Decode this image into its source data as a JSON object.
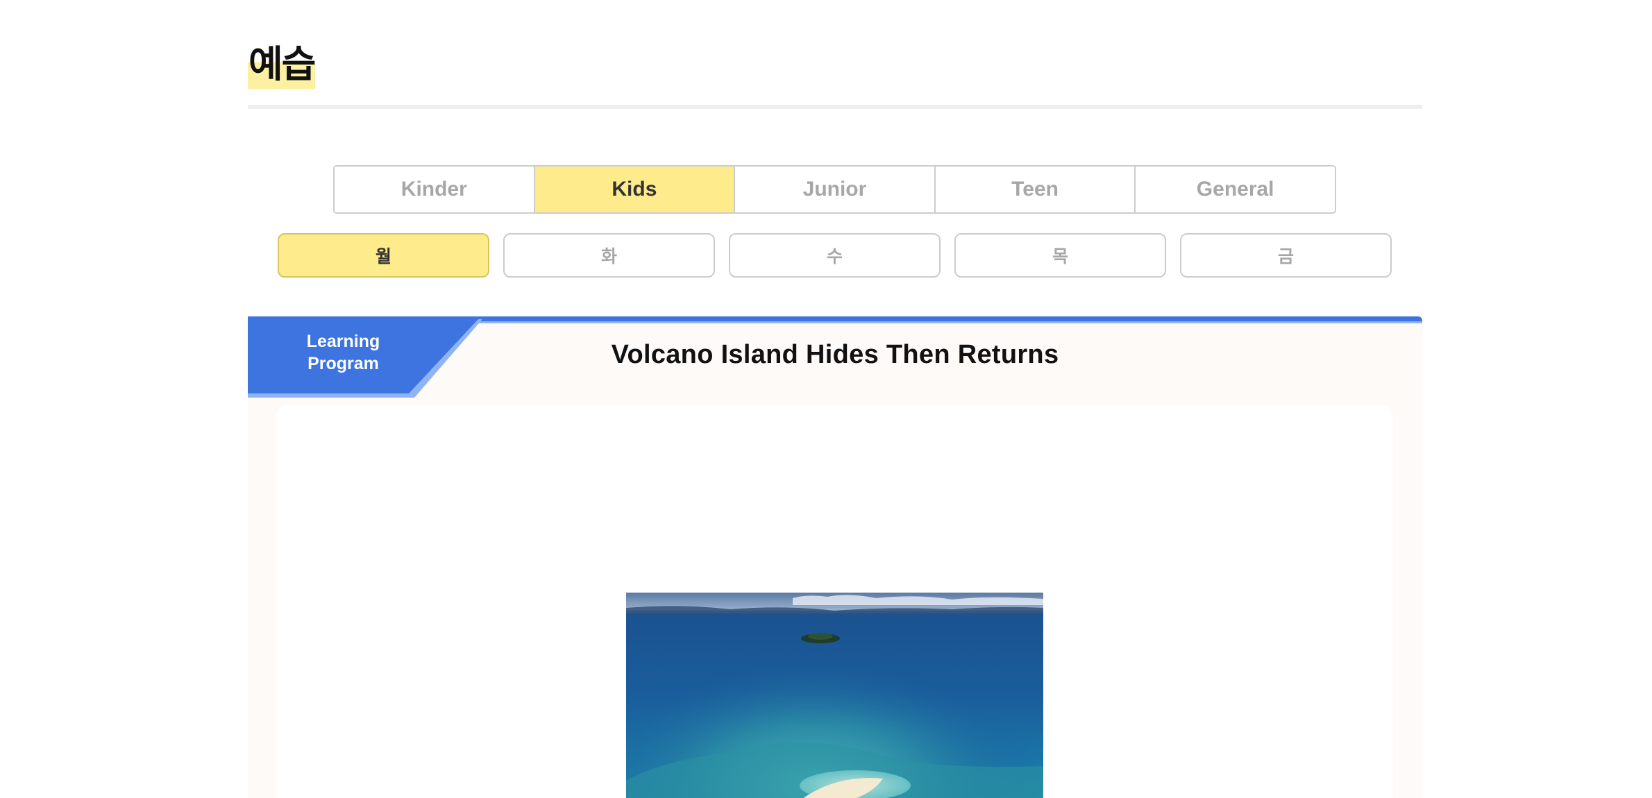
{
  "page": {
    "title": "예습"
  },
  "level_tabs": [
    {
      "label": "Kinder",
      "active": false
    },
    {
      "label": "Kids",
      "active": true
    },
    {
      "label": "Junior",
      "active": false
    },
    {
      "label": "Teen",
      "active": false
    },
    {
      "label": "General",
      "active": false
    }
  ],
  "day_tabs": [
    {
      "label": "월",
      "active": true
    },
    {
      "label": "화",
      "active": false
    },
    {
      "label": "수",
      "active": false
    },
    {
      "label": "목",
      "active": false
    },
    {
      "label": "금",
      "active": false
    }
  ],
  "program": {
    "badge": "Learning\nProgram",
    "title": "Volcano Island Hides Then Returns",
    "image_subject": "aerial-ocean-island-photo"
  },
  "colors": {
    "accent_yellow": "#fdeb8c",
    "accent_blue": "#3d74e0",
    "inactive_text": "#a7a7a7"
  }
}
